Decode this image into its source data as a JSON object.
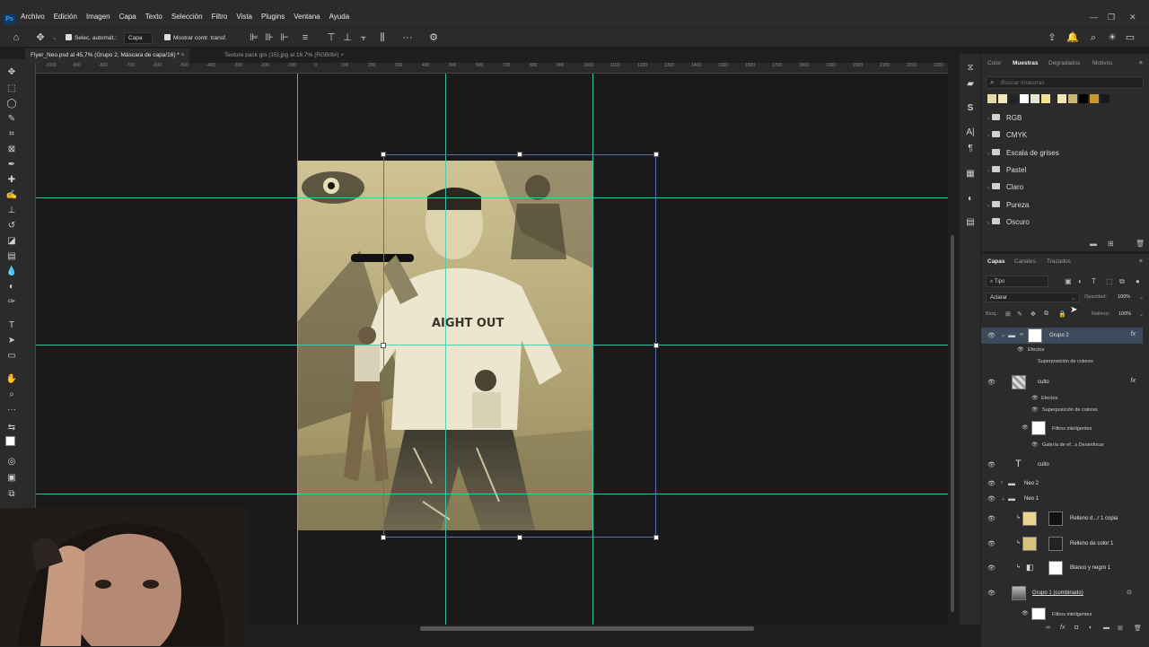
{
  "app": {
    "logo": "Ps",
    "menu": [
      "Archivo",
      "Edición",
      "Imagen",
      "Capa",
      "Texto",
      "Selección",
      "Filtro",
      "Vista",
      "Plugins",
      "Ventana",
      "Ayuda"
    ],
    "window_controls": [
      "—",
      "❐",
      "✕"
    ]
  },
  "options_bar": {
    "auto_select_label": "Selec. automát.:",
    "auto_select_value": "Capa",
    "show_transform_label": "Mostrar contr. transf."
  },
  "doc_tabs": [
    {
      "label": "Flyer_Neo.psd al 45,7% (Grupo 2, Máscara de capa/16) *",
      "active": true
    },
    {
      "label": "Texture pack gio (15).jpg al 16,7% (RGB/8#)",
      "active": false
    }
  ],
  "ruler_ticks": [
    "-1000",
    "-900",
    "-800",
    "-700",
    "-600",
    "-500",
    "-400",
    "-300",
    "-200",
    "-100",
    "0",
    "100",
    "200",
    "300",
    "400",
    "500",
    "600",
    "700",
    "800",
    "900",
    "1000",
    "1100",
    "1200",
    "1300",
    "1400",
    "1500",
    "1600",
    "1700",
    "1800",
    "1900",
    "2000",
    "2100",
    "2200",
    "2300"
  ],
  "swatches_panel": {
    "tabs": [
      "Color",
      "Muestras",
      "Degradados",
      "Motivos"
    ],
    "active_tab": "Muestras",
    "search_placeholder": "Buscar muestras",
    "recent_colors": [
      "#e7d9a3",
      "#f4e7b8",
      "#222222",
      "#ffffff",
      "#e9e4cf",
      "#f4df93",
      "#f1e6b0",
      "#c9b679",
      "#000000",
      "#c69a2c",
      "#1a1a1a"
    ],
    "groups": [
      "RGB",
      "CMYK",
      "Escala de grises",
      "Pastel",
      "Claro",
      "Pureza",
      "Oscuro"
    ]
  },
  "layers_panel": {
    "tabs": [
      "Capas",
      "Canales",
      "Trazados"
    ],
    "active_tab": "Capas",
    "filter_label": "Tipo",
    "blend_mode": "Aclarar",
    "opacity_label": "Opacidad:",
    "opacity_value": "100%",
    "lock_label": "Bloq.:",
    "fill_label": "Relleno:",
    "fill_value": "100%",
    "layers": {
      "grupo2": "Grupo 2",
      "efectos1": "Efectos",
      "superpos1": "Superposición de colores",
      "culto": "culto",
      "efectos2": "Efectos",
      "superpos2": "Superposición de colores",
      "filtros1": "Filtros inteligentes",
      "galeria": "Galería de ef...s Desenfocar",
      "culto_text": "culto",
      "neo2": "Neo 2",
      "neo1": "Neo 1",
      "relleno_copia": "Relleno d...r 1 copia",
      "relleno1": "Relleno de color 1",
      "blanco_negro": "Blanco y negro 1",
      "grupo1": "Grupo 1 (combinado)",
      "filtros2": "Filtros inteligentes"
    }
  },
  "icons": {
    "fx": "fx",
    "eye": "eye-icon"
  }
}
